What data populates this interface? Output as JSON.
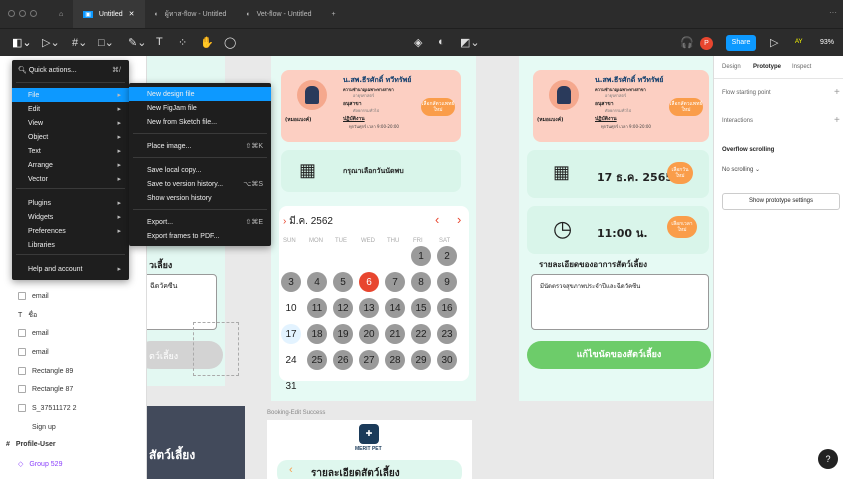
{
  "tabs": [
    {
      "label": "Untitled"
    },
    {
      "label": "ผู้ทาส-flow - Untitled"
    },
    {
      "label": "Vet-flow - Untitled"
    }
  ],
  "toolbar": {
    "share": "Share",
    "avatar": "P",
    "zoom": "93%",
    "user": "AY"
  },
  "main_menu": {
    "quick_actions": "Quick actions...",
    "quick_shortcut": "⌘/",
    "items": [
      {
        "label": "File",
        "sub": "▸"
      },
      {
        "label": "Edit",
        "sub": "▸"
      },
      {
        "label": "View",
        "sub": "▸"
      },
      {
        "label": "Object",
        "sub": "▸"
      },
      {
        "label": "Text",
        "sub": "▸"
      },
      {
        "label": "Arrange",
        "sub": "▸"
      },
      {
        "label": "Vector",
        "sub": "▸"
      },
      {
        "label": "Plugins",
        "sub": "▸"
      },
      {
        "label": "Widgets",
        "sub": "▸"
      },
      {
        "label": "Preferences",
        "sub": "▸"
      },
      {
        "label": "Libraries",
        "sub": ""
      },
      {
        "label": "Help and account",
        "sub": "▸"
      }
    ]
  },
  "file_menu": [
    {
      "label": "New design file",
      "shortcut": ""
    },
    {
      "label": "New FigJam file",
      "shortcut": ""
    },
    {
      "label": "New from Sketch file...",
      "shortcut": ""
    },
    {
      "label": "Place image...",
      "shortcut": "⇧⌘K"
    },
    {
      "label": "Save local copy...",
      "shortcut": ""
    },
    {
      "label": "Save to version history...",
      "shortcut": "⌥⌘S"
    },
    {
      "label": "Show version history",
      "shortcut": ""
    },
    {
      "label": "Export...",
      "shortcut": "⇧⌘E"
    },
    {
      "label": "Export frames to PDF...",
      "shortcut": ""
    }
  ],
  "layers": [
    {
      "label": "email"
    },
    {
      "label": "ชื่อ"
    },
    {
      "label": "email"
    },
    {
      "label": "email"
    },
    {
      "label": "Rectangle 89"
    },
    {
      "label": "Rectangle 87"
    },
    {
      "label": "S_37511172 2"
    },
    {
      "label": "Sign up"
    },
    {
      "label": "Profile-User"
    },
    {
      "label": "Group 529"
    }
  ],
  "right_panel": {
    "tabs": [
      "Design",
      "Prototype",
      "Inspect"
    ],
    "flow": "Flow starting point",
    "interactions": "Interactions",
    "overflow": "Overflow scrolling",
    "no_scroll": "No scrolling",
    "proto_btn": "Show prototype settings"
  },
  "vet": {
    "name": "น.สพ.ธีรศักดิ์ ทวีทรัพย์",
    "title": "ความชำนาญเฉพาะทางสาขา",
    "sub": "อายุรศาสตร์",
    "branch": "อนุสาขา",
    "branch_sub": "ศัลยกรรมทั่วไป",
    "cal": "ปฏิบัติงาน",
    "time": "ทุกวันศุกร์ เวลา 9:00-20:00",
    "tag": "(หมอแบงค์)",
    "badge": "เลือกสัตวแพทย์ใหม่"
  },
  "select_date": "กรุณาเลือกวันนัดพบ",
  "calendar": {
    "month": "มี.ค. 2562",
    "days": [
      "SUN",
      "MON",
      "TUE",
      "WED",
      "THU",
      "FRI",
      "SAT"
    ],
    "dates": [
      "1",
      "2",
      "3",
      "4",
      "5",
      "6",
      "7",
      "8",
      "9",
      "10",
      "11",
      "12",
      "13",
      "14",
      "15",
      "16",
      "17",
      "18",
      "19",
      "20",
      "21",
      "22",
      "23",
      "24",
      "25",
      "26",
      "27",
      "28",
      "29",
      "30",
      "31"
    ]
  },
  "date_value": "17 ธ.ค. 2565",
  "time_value": "11:00 น.",
  "choose": "เลือกวันใหม่",
  "choose_time": "เลือกเวลาใหม่",
  "symptom_label": "รายละเอียดของอาการสัตว์เลี้ยง",
  "symptom_text": "มีนัดตรวจสุขภาพประจำปีและฉีดวัคซีน",
  "edit_btn": "แก้ไขนัดของสัตว์เลี้ยง",
  "pet_label": "วเลี้ยง",
  "pet_text": "ฉีดวัคซีน",
  "pet_btn": "ตว์เลี้ยง",
  "pet_bottom": "สัตว์เลี้ยง",
  "frame_label": "Booking-Edit Success",
  "logo": "MERIT PET",
  "pet_detail": "รายละเอียดสัตว์เลี้ยง",
  "help": "?"
}
